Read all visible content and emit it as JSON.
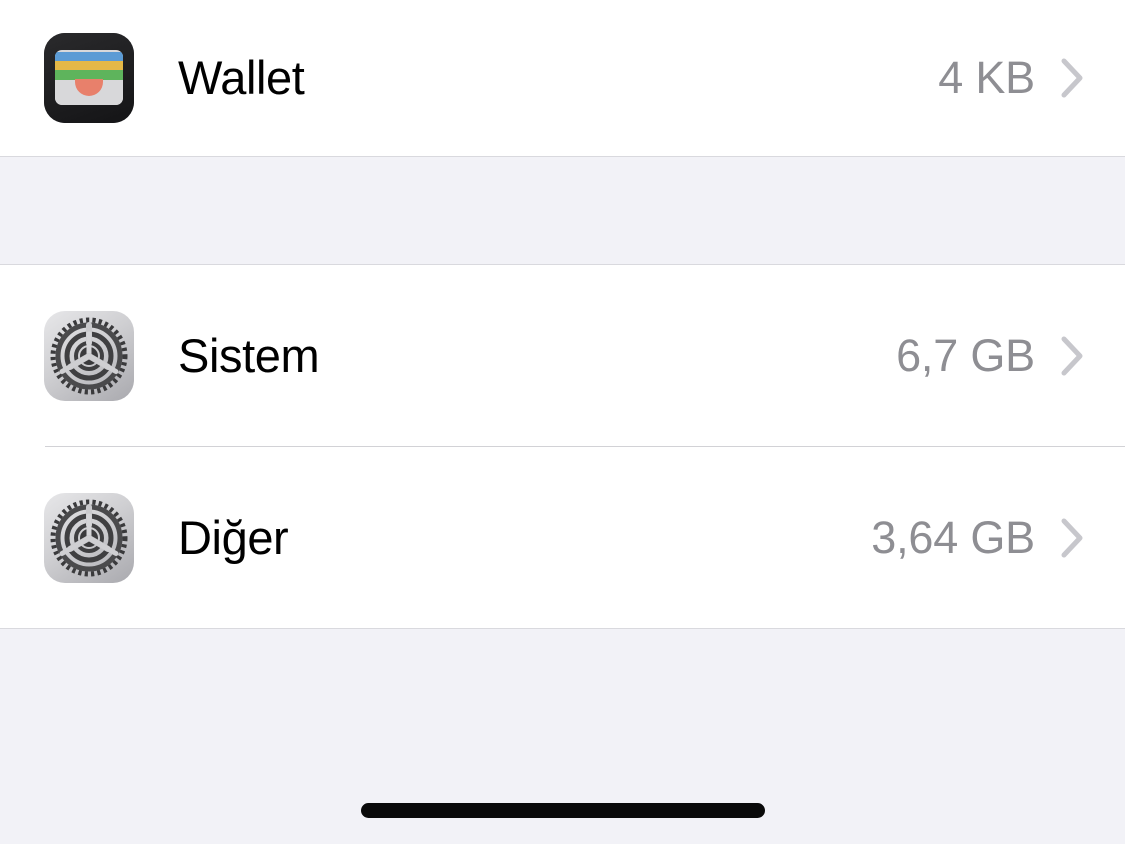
{
  "screen": {
    "name": "iphone-storage-list",
    "background_color": "#f2f2f7",
    "card_color": "#ffffff",
    "separator_color": "#d2d2d6",
    "label_color": "#000000",
    "size_color": "#8e8e93",
    "chevron_color": "#c7c7cc"
  },
  "sections": [
    {
      "id": "apps",
      "rows": [
        {
          "label": "Wallet",
          "size": "4 KB",
          "icon": "wallet-icon",
          "disclosure": "chevron-right-icon"
        }
      ]
    },
    {
      "id": "system",
      "rows": [
        {
          "label": "Sistem",
          "size": "6,7 GB",
          "icon": "settings-gear-icon",
          "disclosure": "chevron-right-icon"
        },
        {
          "label": "Diğer",
          "size": "3,64 GB",
          "icon": "settings-gear-icon",
          "disclosure": "chevron-right-icon"
        }
      ]
    }
  ],
  "home_indicator": {
    "name": "home-indicator",
    "color": "#0a0a0a"
  }
}
